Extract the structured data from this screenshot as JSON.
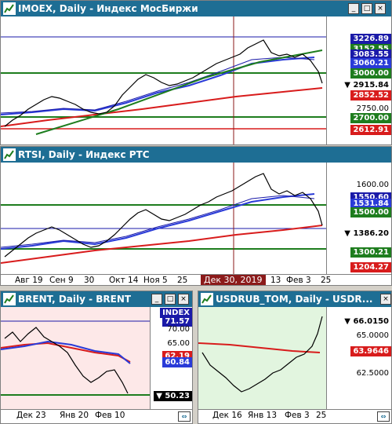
{
  "imoex": {
    "title": "IMOEX, Daily - Индекс МосБиржи",
    "labels": [
      {
        "text": "3226.89",
        "bg": "#1a1aa8"
      },
      {
        "text": "3152.55",
        "bg": "#1e7d1e"
      },
      {
        "text": "3083.55",
        "bg": "#1a1aa8"
      },
      {
        "text": "3060.21",
        "bg": "#2a3bd8"
      },
      {
        "text": "3000.00",
        "bg": "#1e7d1e"
      },
      {
        "text": "2915.84",
        "bg": "#fff",
        "fg": "#000",
        "arrow": "▼ "
      },
      {
        "text": "2852.52",
        "bg": "#d81c1c"
      },
      {
        "text": "2750.00",
        "bg": "transparent",
        "fg": "#000",
        "plain": true
      },
      {
        "text": "2700.00",
        "bg": "#1e7d1e"
      },
      {
        "text": "2612.91",
        "bg": "#d81c1c"
      }
    ]
  },
  "rtsi": {
    "title": "RTSI, Daily - Индекс РТС",
    "labels": [
      {
        "text": "1600.00",
        "bg": "transparent",
        "fg": "#000",
        "plain": true
      },
      {
        "text": "1550.60",
        "bg": "#1a1aa8"
      },
      {
        "text": "1531.84",
        "bg": "#2a3bd8"
      },
      {
        "text": "1500.00",
        "bg": "#1e7d1e"
      },
      {
        "text": "1386.20",
        "bg": "#fff",
        "fg": "#000",
        "arrow": "▼ "
      },
      {
        "text": "1300.21",
        "bg": "#1e7d1e"
      },
      {
        "text": "1204.27",
        "bg": "#d81c1c"
      }
    ],
    "xaxis": [
      "Авг 19",
      "Сен 9",
      "30",
      "Окт 14",
      "Ноя 5",
      "25",
      "13",
      "Фев 3",
      "25"
    ],
    "cursor_date": "Дек 30, 2019"
  },
  "brent": {
    "title": "BRENT, Daily - BRENT",
    "index_tag": "INDEX",
    "labels": [
      {
        "text": "71.57",
        "bg": "#1a1aa8"
      },
      {
        "text": "70.00",
        "bg": "transparent",
        "fg": "#000",
        "plain": true
      },
      {
        "text": "65.00",
        "bg": "transparent",
        "fg": "#000",
        "plain": true
      },
      {
        "text": "62.19",
        "bg": "#d81c1c"
      },
      {
        "text": "60.84",
        "bg": "#2a3bd8"
      },
      {
        "text": "50.23",
        "bg": "#000",
        "arrow": "▼ "
      }
    ],
    "xaxis": [
      "Дек 23",
      "Янв 20",
      "Фев 10"
    ]
  },
  "usdrub": {
    "title": "USDRUB_TOM, Daily - USDR...",
    "labels": [
      {
        "text": "66.0150",
        "bg": "#fff",
        "fg": "#000",
        "arrow": "▼ "
      },
      {
        "text": "65.0000",
        "bg": "transparent",
        "fg": "#000",
        "plain": true
      },
      {
        "text": "63.9646",
        "bg": "#d81c1c"
      },
      {
        "text": "62.5000",
        "bg": "transparent",
        "fg": "#000",
        "plain": true
      }
    ],
    "xaxis": [
      "Дек 16",
      "Янв 13",
      "Фев 3",
      "25"
    ]
  },
  "buttons": {
    "minimize": "_",
    "maximize": "□",
    "close": "×",
    "expand": "⇔"
  }
}
